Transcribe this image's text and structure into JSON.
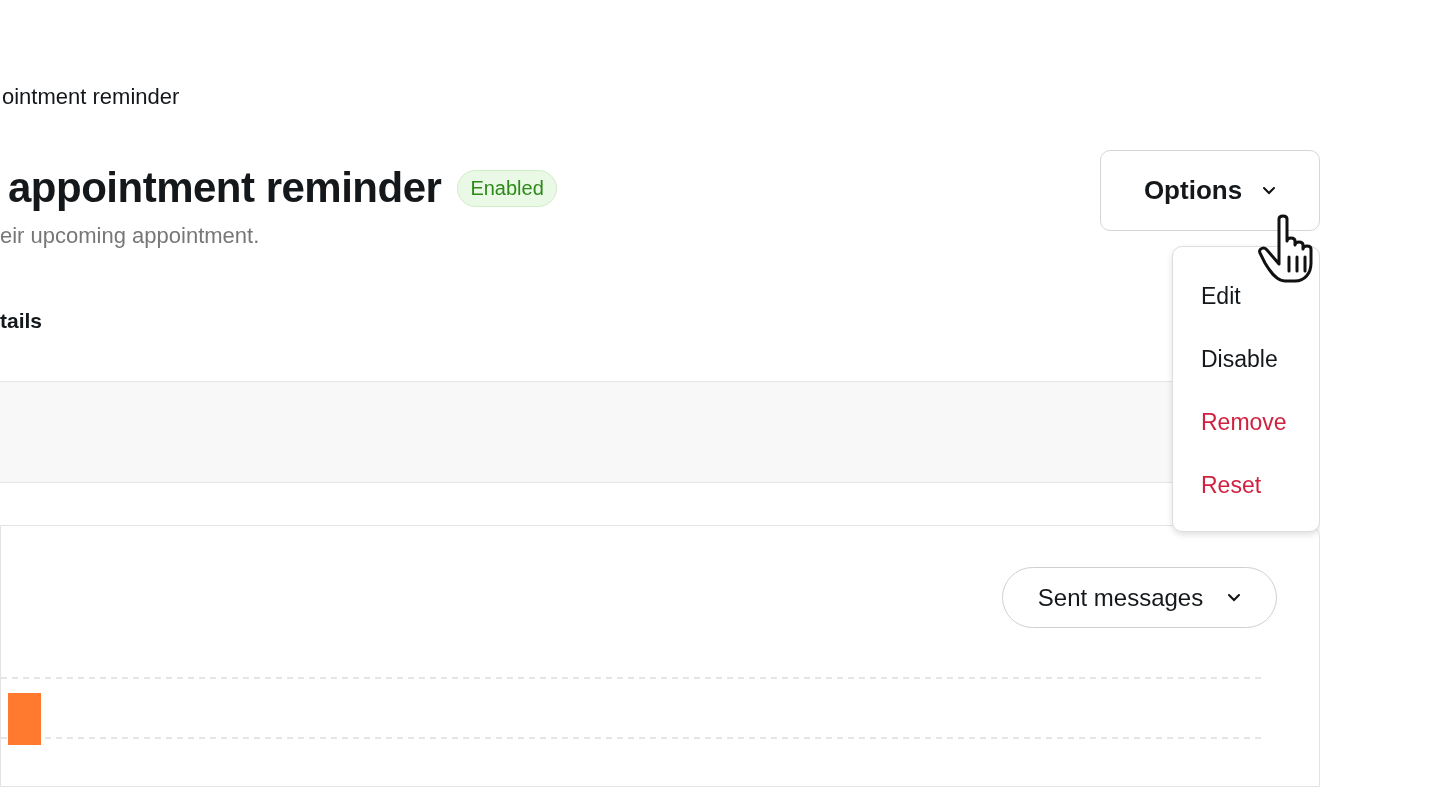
{
  "breadcrumb": "ointment reminder",
  "header": {
    "title": "appointment reminder",
    "badge": {
      "label": "Enabled",
      "kind": "success"
    },
    "subtitle": "eir upcoming appointment."
  },
  "options_button": {
    "label": "Options"
  },
  "options_menu": [
    {
      "label": "Edit",
      "kind": "default"
    },
    {
      "label": "Disable",
      "kind": "default"
    },
    {
      "label": "Remove",
      "kind": "danger"
    },
    {
      "label": "Reset",
      "kind": "danger"
    }
  ],
  "section_heading": "tails",
  "chart_card": {
    "metric_dropdown": "Sent messages"
  }
}
